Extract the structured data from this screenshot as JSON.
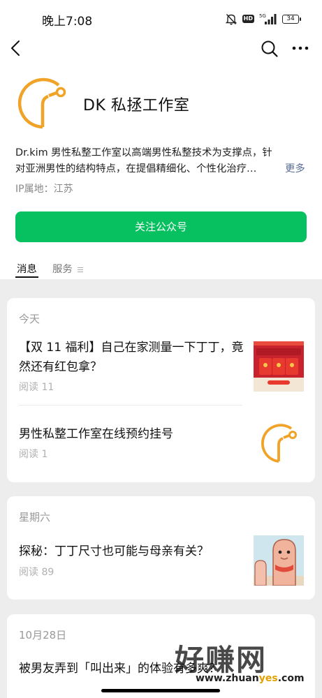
{
  "status_bar": {
    "time": "晚上7:08",
    "network": "5G",
    "battery": "34"
  },
  "account": {
    "name": "DK 私拯工作室",
    "description_line1": "Dr.kim 男性私整工作室以高端男性私整技术为支撑点，针",
    "description_line2": "对亚洲男性的结构特点，在提倡精细化、个性化治疗…",
    "more_label": "更多",
    "ip_location": "IP属地：江苏",
    "logo_color": "#f0a326"
  },
  "follow_button": {
    "label": "关注公众号",
    "color": "#07c160"
  },
  "tabs": [
    {
      "label": "消息",
      "active": true
    },
    {
      "label": "服务",
      "active": false
    }
  ],
  "groups": [
    {
      "date": "今天",
      "articles": [
        {
          "title_line1": "【双 11 福利】自己在家测量一下丁丁，竟",
          "title_line2": "然还有红包拿？",
          "reads": "阅读 11",
          "thumb": "red-envelope-image"
        },
        {
          "title_line1": "男性私整工作室在线预约挂号",
          "title_line2": "",
          "reads": "阅读 1",
          "thumb": "account-logo-image"
        }
      ]
    },
    {
      "date": "星期六",
      "articles": [
        {
          "title_line1": "探秘：丁丁尺寸也可能与母亲有关？",
          "title_line2": "",
          "reads": "阅读 89",
          "thumb": "cartoon-image"
        }
      ]
    },
    {
      "date": "10月28日",
      "articles": [
        {
          "title_line1": "被男友弄到「叫出来」的体验有多爽？",
          "title_line2": "",
          "reads": "",
          "thumb": ""
        }
      ]
    }
  ],
  "watermark": {
    "text": "好赚网",
    "url_prefix": "www.zhuan",
    "url_highlight": "yes",
    "url_suffix": ".com"
  }
}
